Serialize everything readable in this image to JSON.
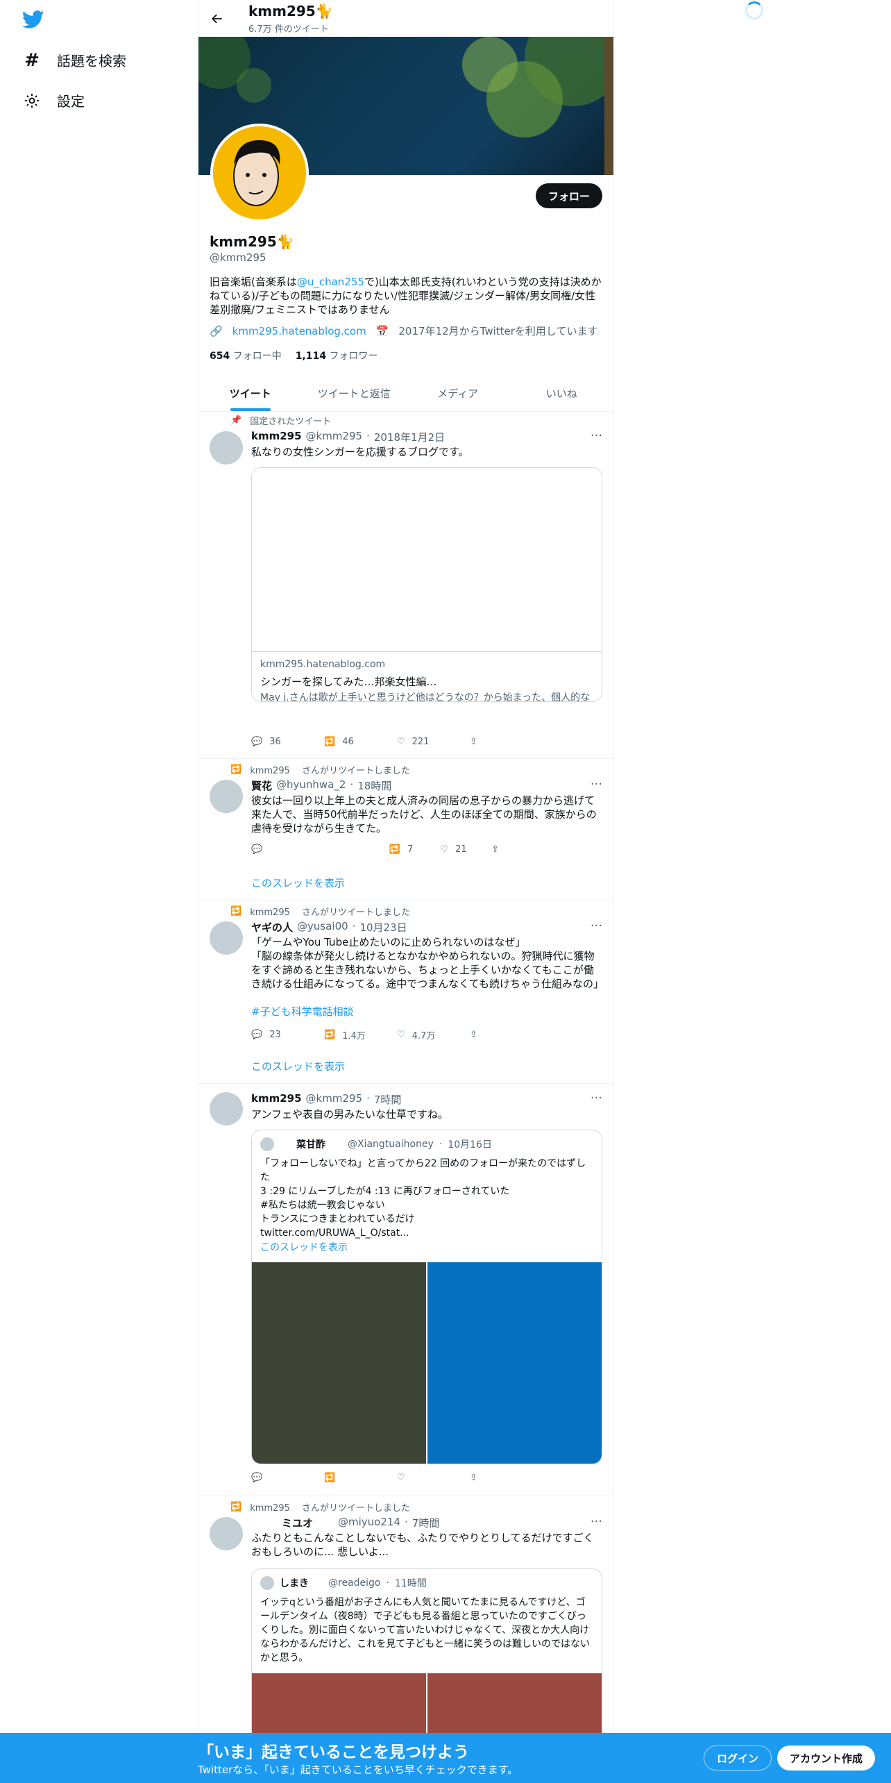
{
  "nav": {
    "explore_label": "話題を検索",
    "settings_label": "設定"
  },
  "header": {
    "name": "kmm295🐈",
    "tweet_count": "6.7万 件のツイート"
  },
  "profile": {
    "follow_label": "フォロー",
    "name": "kmm295🐈",
    "handle": "@kmm295",
    "bio_before": "旧音楽垢(音楽系は",
    "bio_mention": "@u_chan255",
    "bio_after": "で)山本太郎氏支持(れいわという党の支持は決めかねている)/子どもの問題に力になりたい/性犯罪撲滅/ジェンダー解体/男女同権/女性差別撤廃/フェミニストではありません",
    "website": "kmm295.hatenablog.com",
    "joined": "2017年12月からTwitterを利用しています",
    "following_count": "654",
    "following_label": "フォロー中",
    "followers_count": "1,114",
    "followers_label": "フォロワー"
  },
  "tabs": [
    "ツイート",
    "ツイートと返信",
    "メディア",
    "いいね"
  ],
  "tweets": [
    {
      "context": "固定されたツイート",
      "name": "kmm295",
      "handle": "@kmm295",
      "date": "2018年1月2日",
      "text": "私なりの女性シンガーを応援するブログです。",
      "card": {
        "domain": "kmm295.hatenablog.com",
        "title": "シンガーを探してみた…邦楽女性編…",
        "desc": "May j.さんは歌が上手いと思うけど他はどうなの？から始まった、個人的な感想で書いている私なりの応援ブログです。"
      },
      "replies": "36",
      "retweets": "46",
      "likes": "221"
    },
    {
      "context": "kmm295　 さんがリツイートしました",
      "name": "賢花",
      "handle": "@hyunhwa_2",
      "date": "18時間",
      "text": "彼女は一回り以上年上の夫と成人済みの同居の息子からの暴力から逃げて来た人で、当時50代前半だったけど、人生のほぼ全ての期間、家族からの虐待を受けながら生きてた。",
      "replies": "",
      "retweets": "7",
      "likes": "21",
      "thread": "このスレッドを表示"
    },
    {
      "context": "kmm295　 さんがリツイートしました",
      "name": "ヤギの人",
      "handle": "@yusai00",
      "date": "10月23日",
      "text": "「ゲームやYou Tube止めたいのに止められないのはなぜ」\n「脳の線条体が発火し続けるとなかなかやめられないの。狩猟時代に獲物をすぐ諦めると生き残れないから、ちょっと上手くいかなくてもここが働き続ける仕組みになってる。途中でつまんなくても続けちゃう仕組みなの」",
      "hashtag": "#子ども科学電話相談",
      "replies": "23",
      "retweets": "1.4万",
      "likes": "4.7万",
      "thread": "このスレッドを表示"
    },
    {
      "name": "kmm295",
      "handle": "@kmm295",
      "date": "7時間",
      "text": "アンフェや表自の男みたいな仕草ですね。",
      "quote": {
        "name": "菜甘酢",
        "handle": "@Xiangtuaihoney",
        "date": "10月16日",
        "text": "「フォローしないでね」と言ってから22 回めのフォローが来たのではずした\n3 :29 にリムーブしたが4 :13 に再びフォローされていた\n#私たちは統一教会じゃない\nトランスにつきまとわれているだけ\ntwitter.com/URUWA_L_O/stat...",
        "thread": "このスレッドを表示"
      }
    },
    {
      "context": "kmm295　 さんがリツイートしました",
      "name": "ミユオ",
      "handle": "@miyuo214",
      "date": "7時間",
      "text": "ふたりともこんなことしないでも、ふたりでやりとりしてるだけですごくおもしろいのに... 悲しいよ...",
      "quote": {
        "name": "しまき",
        "handle": "@readeigo",
        "date": "11時間",
        "text": "イッテqという番組がお子さんにも人気と聞いてたまに見るんですけど、ゴールデンタイム（夜8時）で子どもも見る番組と思っていたのですごくびっくりした。別に面白くないって言いたいわけじゃなくて、深夜とか大人向けならわかるんだけど、これを見て子どもと一緒に笑うのは難しいのではないかと思う。"
      }
    }
  ],
  "bottom": {
    "title": "「いま」起きていることを見つけよう",
    "subtitle": "Twitterなら、「いま」起きていることをいち早くチェックできます。",
    "login": "ログイン",
    "signup": "アカウント作成"
  },
  "colors": {
    "accent": "#1d9bf0",
    "text": "#0f1419",
    "muted": "#536471"
  }
}
